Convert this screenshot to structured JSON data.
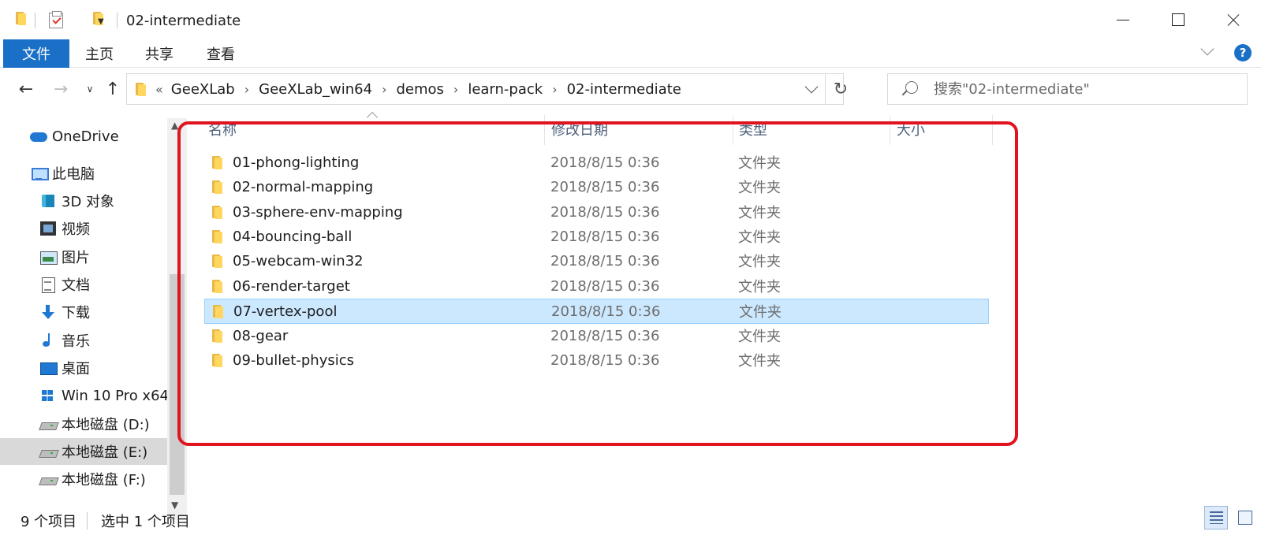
{
  "window": {
    "title": "02-intermediate",
    "quick_access": [
      "folder-icon",
      "properties-icon",
      "new-folder-icon",
      "customize-dropdown-icon"
    ],
    "controls": [
      "minimize-icon",
      "maximize-icon",
      "close-icon"
    ]
  },
  "ribbon": {
    "tabs": [
      {
        "label": "文件",
        "active": true
      },
      {
        "label": "主页"
      },
      {
        "label": "共享"
      },
      {
        "label": "查看"
      }
    ],
    "help": "?",
    "accent_color": "#1a6fc6"
  },
  "nav": {
    "back": "←",
    "forward": "→",
    "recent": "∨",
    "up": "↑",
    "breadcrumb_overflow": "«",
    "breadcrumb": [
      "GeeXLab",
      "GeeXLab_win64",
      "demos",
      "learn-pack",
      "02-intermediate"
    ],
    "refresh": "↻",
    "search_placeholder": "搜索\"02-intermediate\""
  },
  "sidebar": {
    "items": [
      {
        "label": "OneDrive",
        "icon": "onedrive-cloud-icon"
      },
      {
        "label": "此电脑",
        "icon": "this-pc-icon"
      },
      {
        "label": "3D 对象",
        "icon": "3d-objects-icon"
      },
      {
        "label": "视频",
        "icon": "videos-icon"
      },
      {
        "label": "图片",
        "icon": "pictures-icon"
      },
      {
        "label": "文档",
        "icon": "documents-icon"
      },
      {
        "label": "下载",
        "icon": "downloads-icon"
      },
      {
        "label": "音乐",
        "icon": "music-icon"
      },
      {
        "label": "桌面",
        "icon": "desktop-icon"
      },
      {
        "label": "Win 10 Pro x64",
        "icon": "windows-drive-icon"
      },
      {
        "label": "本地磁盘 (D:)",
        "icon": "local-disk-icon"
      },
      {
        "label": "本地磁盘 (E:)",
        "icon": "local-disk-icon",
        "selected": true
      },
      {
        "label": "本地磁盘 (F:)",
        "icon": "local-disk-icon"
      }
    ]
  },
  "filelist": {
    "columns": [
      "名称",
      "修改日期",
      "类型",
      "大小"
    ],
    "rows": [
      {
        "name": "01-phong-lighting",
        "date": "2018/8/15 0:36",
        "type": "文件夹"
      },
      {
        "name": "02-normal-mapping",
        "date": "2018/8/15 0:36",
        "type": "文件夹"
      },
      {
        "name": "03-sphere-env-mapping",
        "date": "2018/8/15 0:36",
        "type": "文件夹"
      },
      {
        "name": "04-bouncing-ball",
        "date": "2018/8/15 0:36",
        "type": "文件夹"
      },
      {
        "name": "05-webcam-win32",
        "date": "2018/8/15 0:36",
        "type": "文件夹"
      },
      {
        "name": "06-render-target",
        "date": "2018/8/15 0:36",
        "type": "文件夹"
      },
      {
        "name": "07-vertex-pool",
        "date": "2018/8/15 0:36",
        "type": "文件夹",
        "selected": true
      },
      {
        "name": "08-gear",
        "date": "2018/8/15 0:36",
        "type": "文件夹"
      },
      {
        "name": "09-bullet-physics",
        "date": "2018/8/15 0:36",
        "type": "文件夹"
      }
    ],
    "selection_color": "#cce8ff",
    "highlight_color": "#e0141e"
  },
  "status": {
    "item_count": "9 个项目",
    "selected_count": "选中 1 个项目",
    "views": [
      "details-view-icon",
      "large-icons-view-icon"
    ]
  }
}
